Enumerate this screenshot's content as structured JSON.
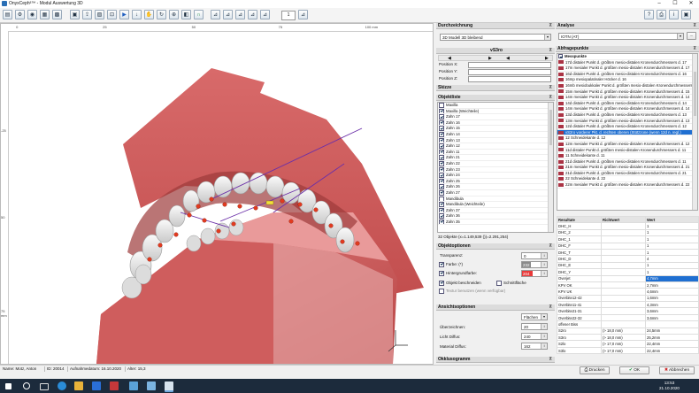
{
  "window": {
    "title": "OnyxCeph³™ - Modul Auswertung 3D",
    "min": "–",
    "max": "☐",
    "close": "✕"
  },
  "toolbar": {
    "zoom_value": "1"
  },
  "ruler": {
    "top_ticks": [
      {
        "label": "0",
        "pos": 0.035
      },
      {
        "label": "25",
        "pos": 0.235
      },
      {
        "label": "50",
        "pos": 0.44
      },
      {
        "label": "75",
        "pos": 0.64
      },
      {
        "label": "100 mm",
        "pos": 0.84
      }
    ],
    "left_ticks": [
      {
        "label": "-25",
        "pos": 0.29
      },
      {
        "label": "50",
        "pos": 0.55
      },
      {
        "label": "75 mm",
        "pos": 0.83
      }
    ]
  },
  "durchzeichnung": {
    "header": "Durchzeichnung",
    "value": "3D Modell 3D bleibend"
  },
  "vs3ro": {
    "header": "vS3ro",
    "rows": [
      {
        "label": "Position X:",
        "value": ""
      },
      {
        "label": "Position Y:",
        "value": ""
      },
      {
        "label": "Position Z:",
        "value": ""
      }
    ]
  },
  "skizze": {
    "header": "Skizze"
  },
  "objektliste": {
    "header": "Objektliste",
    "items": [
      {
        "label": "Maxilla",
        "checked": false
      },
      {
        "label": "Maxilla (Weichteile)",
        "checked": true
      },
      {
        "label": "Zahn 17",
        "checked": true
      },
      {
        "label": "Zahn 16",
        "checked": true
      },
      {
        "label": "Zahn 15",
        "checked": true
      },
      {
        "label": "Zahn 14",
        "checked": true
      },
      {
        "label": "Zahn 13",
        "checked": true
      },
      {
        "label": "Zahn 12",
        "checked": true
      },
      {
        "label": "Zahn 11",
        "checked": true
      },
      {
        "label": "Zahn 21",
        "checked": true
      },
      {
        "label": "Zahn 22",
        "checked": true
      },
      {
        "label": "Zahn 23",
        "checked": true
      },
      {
        "label": "Zahn 24",
        "checked": true
      },
      {
        "label": "Zahn 25",
        "checked": true
      },
      {
        "label": "Zahn 26",
        "checked": true
      },
      {
        "label": "Zahn 27",
        "checked": true
      },
      {
        "label": "Mandibula",
        "checked": false
      },
      {
        "label": "Mandibula (Weichteile)",
        "checked": true
      },
      {
        "label": "Zahn 37",
        "checked": true
      },
      {
        "label": "Zahn 36",
        "checked": true
      },
      {
        "label": "Zahn 35",
        "checked": true
      }
    ],
    "footer": "32 Objekte (x=1.149,539 ())=2.291,254)"
  },
  "objektoptionen": {
    "header": "Objektoptionen",
    "transparenz_label": "Transparenz:",
    "transparenz_value": "0",
    "farbe_label": "Farbe: (*)",
    "farbe_value": "232",
    "farbe_color": "#8a8a8a",
    "hintergrund_label": "Hintergrundfarbe:",
    "hintergrund_value": "204",
    "hintergrund_color": "#e83a3a",
    "objekt_label": "Objekt beschneiden",
    "schnitt_label": "Schnittfläche",
    "textur_label": "Textur benutzen (wenn verfügbar)"
  },
  "ansichtsoptionen": {
    "header": "Ansichtsoptionen",
    "mode_value": "Flächen",
    "ueberzeichnen_label": "Überzeichnen:",
    "ueberzeichnen_value": "20",
    "licht_label": "Licht Diffus:",
    "licht_value": "240",
    "material_label": "Material Diffus:",
    "material_value": "162"
  },
  "okklusogramm": {
    "header": "Okklusogramm"
  },
  "analyse": {
    "header": "Analyse",
    "value": "IOTN (AT)",
    "more": "..."
  },
  "abfragepunkte": {
    "header": "Abfragepunkte",
    "group": "Messpunkte",
    "items": [
      "17d distaler Punkt d. größten mesio-distalen Kronendurchmessers d. 17",
      "17m mesialer Punkt d. größten mesio-distalen Kronendurchmessers d. 17",
      "16d distaler Punkt d. größten mesio-distalen Kronendurchmessers d. 16",
      "16mp mesiopalatinaler Höcker d. 16",
      "16mb mesiobukkaler Punkt d. größten mesio-distalen Kronendurchmessers d.",
      "15m mesialer Punkt d. größten mesio-distalen Kronendurchmessers d. 15",
      "14m mesialer Punkt d. größten mesio-distalen Kronendurchmessers d. 14",
      "14d distaler Punkt d. größten mesio-distalen Kronendurchmessers d. 14",
      "14m mesialer Punkt d. größten mesio-distalen Kronendurchmessers d. 14",
      "13d distaler Punkt d. größten mesio-distalen Kronendurchmessers d. 13",
      "13m mesialer Punkt d. größten mesio-distalen Kronendurchmessers d. 13",
      "12d distaler Punkt d. größten mesio-distalen Kronendurchmessers d. 12",
      "vS2ro vorderer Pkt. d. rechten oberen (Stützzone (wenn 12d n. regl.)",
      "12 Schneidekante d. 12",
      "12m mesialer Punkt d. größten mesio-distalen Kronendurchmessers d. 12",
      "11d distaler Punkt d. größten mesio-distalen Kronendurchmessers d. 11",
      "11 Schneidekante d. 11",
      "21d distaler Punkt d. größten mesio-distalen Kronendurchmessers d. 11",
      "21m mesialer Punkt d. größten mesio-distalen Kronendurchmessers d. 21",
      "21d distaler Punkt d. größten mesio-distalen Kronendurchmessers d. 21",
      "22 Schneidekante d. 22",
      "22m mesialer Punkt d. größten mesio-distalen Kronendurchmessers d. 22"
    ],
    "selected_index": 12
  },
  "resultate": {
    "columns": [
      "Resultate",
      "Richtwert",
      "Wert"
    ],
    "rows": [
      {
        "name": "DHC_H",
        "ref": "",
        "val": "1"
      },
      {
        "name": "DHC_2",
        "ref": "",
        "val": "1"
      },
      {
        "name": "DHC_1",
        "ref": "",
        "val": "1"
      },
      {
        "name": "DHC_F",
        "ref": "",
        "val": "1"
      },
      {
        "name": "DHC_T",
        "ref": "",
        "val": "1"
      },
      {
        "name": "DHC_D",
        "ref": "",
        "val": "4"
      },
      {
        "name": "DHC_E",
        "ref": "",
        "val": "1"
      },
      {
        "name": "DHC_Y",
        "ref": "",
        "val": "1"
      },
      {
        "name": "Overjet",
        "ref": "",
        "val": "4,7mm"
      },
      {
        "name": "KPV OK",
        "ref": "",
        "val": "2,7mm"
      },
      {
        "name": "KPV UK",
        "ref": "",
        "val": "4,6mm"
      },
      {
        "name": "Overbite12-42",
        "ref": "",
        "val": "1,6mm"
      },
      {
        "name": "Overbite11-41",
        "ref": "",
        "val": "4,3mm"
      },
      {
        "name": "Overbite21-31",
        "ref": "",
        "val": "3,6mm"
      },
      {
        "name": "Overbite22-32",
        "ref": "",
        "val": "3,6mm"
      },
      {
        "name": "offener Biss",
        "ref": "",
        "val": ""
      },
      {
        "name": "S2ro",
        "ref": "(> 18,0 mm)",
        "val": "24,5mm"
      },
      {
        "name": "S3ro",
        "ref": "(> 18,0 mm)",
        "val": "25,2mm"
      },
      {
        "name": "S2lo",
        "ref": "(> 17,0 mm)",
        "val": "22,4mm"
      },
      {
        "name": "S3lo",
        "ref": "(> 17,0 mm)",
        "val": "22,4mm"
      }
    ],
    "selected_index": 8
  },
  "buttons": {
    "drucken": "Drucken",
    "ok": "OK",
    "abbrechen": "Abbrechen"
  },
  "status": {
    "name": "Name: Motz, Anton",
    "id": "ID: 20014",
    "aufnahme": "Aufnahmedatum: 16.10.2020",
    "alter": "Alter: 15,3"
  },
  "taskbar": {
    "time": "13:53",
    "date": "21.10.2020"
  }
}
